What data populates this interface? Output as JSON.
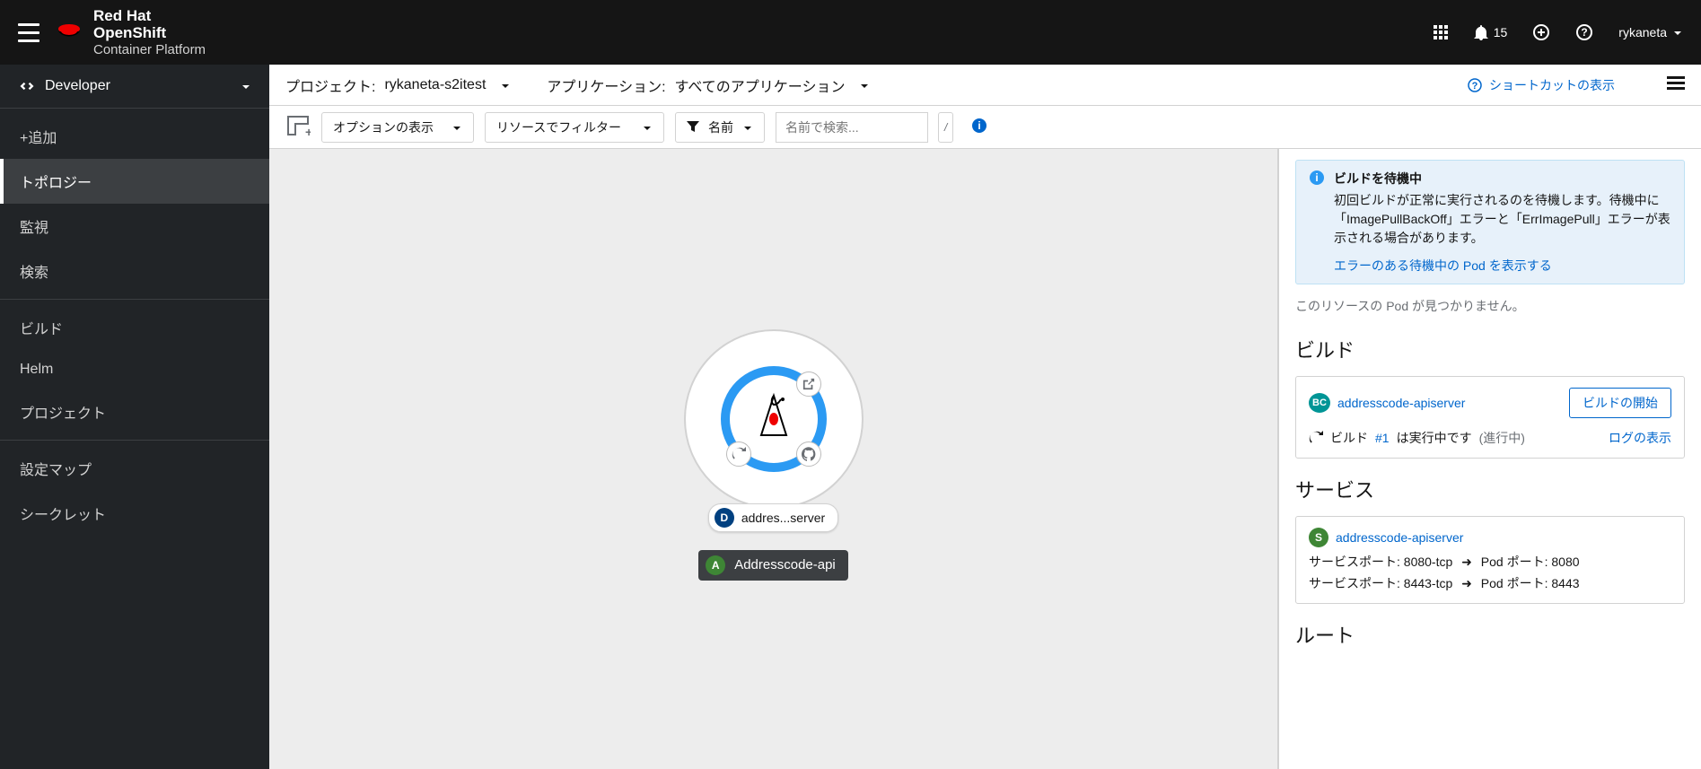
{
  "masthead": {
    "brand_line1": "Red Hat",
    "brand_line2": "OpenShift",
    "brand_line3": "Container Platform",
    "notification_count": "15",
    "username": "rykaneta"
  },
  "perspective": {
    "label": "Developer"
  },
  "nav": {
    "group1": [
      {
        "label": "+追加",
        "id": "add"
      },
      {
        "label": "トポロジー",
        "id": "topology",
        "active": true
      },
      {
        "label": "監視",
        "id": "monitoring"
      },
      {
        "label": "検索",
        "id": "search"
      }
    ],
    "group2": [
      {
        "label": "ビルド",
        "id": "builds"
      },
      {
        "label": "Helm",
        "id": "helm"
      },
      {
        "label": "プロジェクト",
        "id": "project"
      }
    ],
    "group3": [
      {
        "label": "設定マップ",
        "id": "configmaps"
      },
      {
        "label": "シークレット",
        "id": "secrets"
      }
    ]
  },
  "contextbar": {
    "project_label": "プロジェクト:",
    "project_value": "rykaneta-s2itest",
    "application_label": "アプリケーション:",
    "application_value": "すべてのアプリケーション",
    "shortcuts": "ショートカットの表示"
  },
  "toolbar": {
    "display_options": "オプションの表示",
    "resource_filter": "リソースでフィルター",
    "name_filter_type": "名前",
    "search_placeholder": "名前で検索...",
    "kbd": "/"
  },
  "canvas": {
    "node_short": "addres...server",
    "app_name": "Addresscode-api"
  },
  "panel": {
    "alert_title": "ビルドを待機中",
    "alert_body": "初回ビルドが正常に実行されるのを待機します。待機中に「ImagePullBackOff」エラーと「ErrImagePull」エラーが表示される場合があります。",
    "alert_link": "エラーのある待機中の Pod を表示する",
    "no_pods": "このリソースの Pod が見つかりません。",
    "build_section": "ビルド",
    "buildconfig_name": "addresscode-apiserver",
    "start_build": "ビルドの開始",
    "build_running_prefix": "ビルド",
    "build_running_link": "#1",
    "build_running_suffix1": "は実行中です",
    "build_running_suffix2": "(進行中)",
    "view_log": "ログの表示",
    "service_section": "サービス",
    "service_name": "addresscode-apiserver",
    "svc_port_label": "サービスポート:",
    "pod_port_label": "Pod ポート:",
    "svc_port1_name": "8080-tcp",
    "svc_port1_pod": "8080",
    "svc_port2_name": "8443-tcp",
    "svc_port2_pod": "8443",
    "route_section": "ルート"
  }
}
